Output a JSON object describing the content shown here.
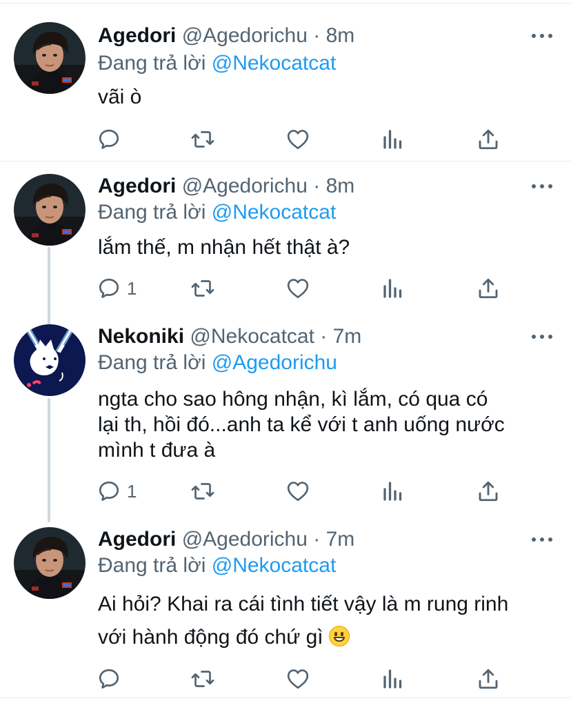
{
  "tweets": [
    {
      "name": "Agedori",
      "handle": "@Agedorichu",
      "sep": " · ",
      "time": "8m",
      "replying_prefix": "Đang trả lời ",
      "replying_to": "@Nekocatcat",
      "text": "vãi ò",
      "reply_count": "",
      "avatar": "agedori-avatar"
    },
    {
      "name": "Agedori",
      "handle": "@Agedorichu",
      "sep": " · ",
      "time": "8m",
      "replying_prefix": "Đang trả lời ",
      "replying_to": "@Nekocatcat",
      "text": "lắm thế, m nhận hết thật à?",
      "reply_count": "1",
      "avatar": "agedori-avatar"
    },
    {
      "name": "Nekoniki",
      "handle": "@Nekocatcat",
      "sep": " · ",
      "time": "7m",
      "replying_prefix": "Đang trả lời ",
      "replying_to": "@Agedorichu",
      "text_lines": [
        "ngta cho sao hông nhận, kì lắm, có qua có",
        "lại th, hồi đó...anh ta kể với t anh uống nước",
        "mình t đưa à"
      ],
      "reply_count": "1",
      "avatar": "nekoniki-avatar"
    },
    {
      "name": "Agedori",
      "handle": "@Agedorichu",
      "sep": " · ",
      "time": "7m",
      "replying_prefix": "Đang trả lời ",
      "replying_to": "@Nekocatcat",
      "text_lines": [
        "Ai hỏi? Khai ra cái tình tiết vậy là m rung rinh",
        "với hành động đó chứ gì"
      ],
      "emoji": "grinning-face",
      "reply_count": "",
      "avatar": "agedori-avatar"
    }
  ],
  "icons": {
    "reply": "reply-icon",
    "retweet": "retweet-icon",
    "like": "heart-icon",
    "analytics": "analytics-icon",
    "share": "share-icon",
    "more": "more-icon"
  },
  "colors": {
    "mention": "#1d9bf0",
    "secondary_text": "#536471",
    "icon": "#536471",
    "thread_line": "#cfd9de"
  }
}
